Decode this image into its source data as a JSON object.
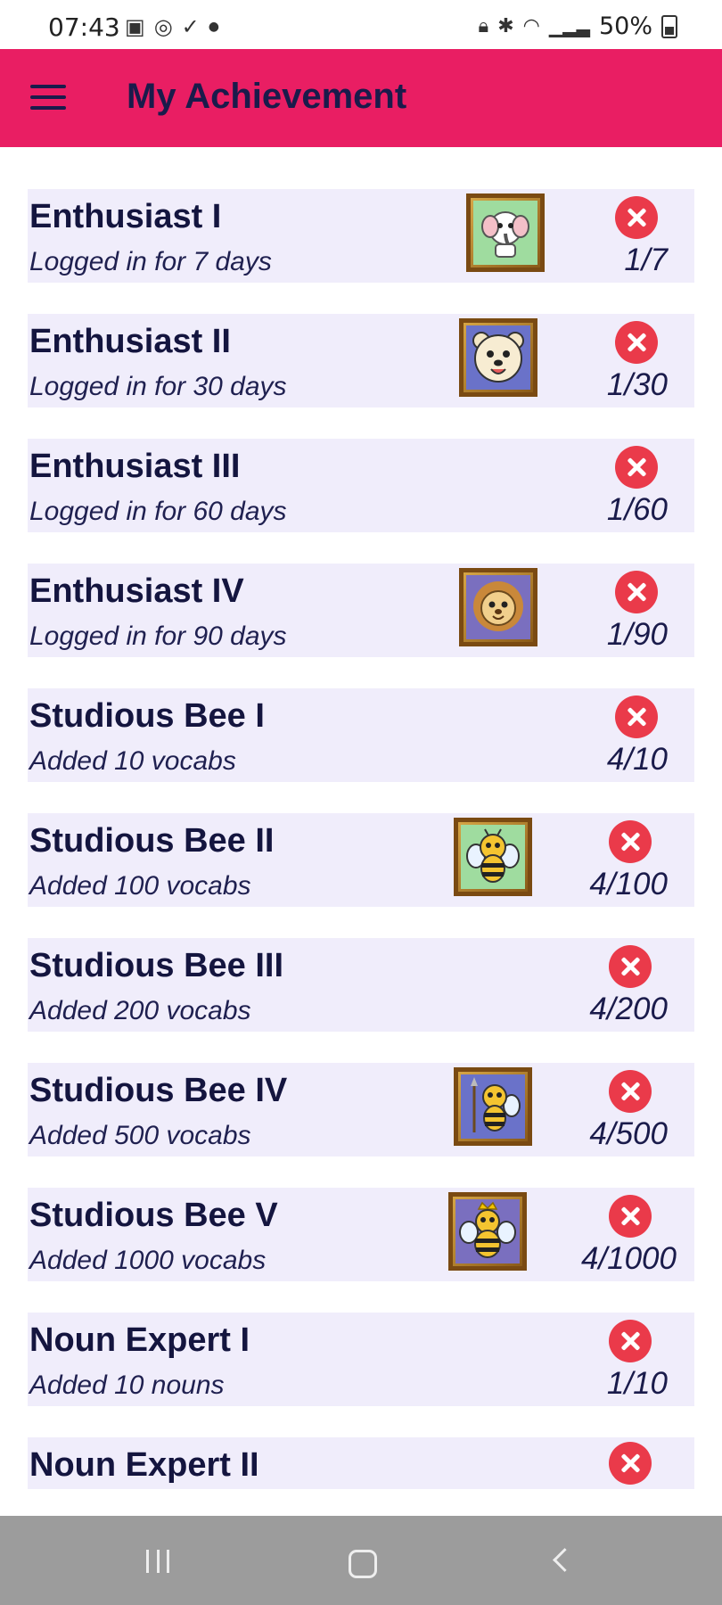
{
  "status_bar": {
    "time": "07:43",
    "battery": "50%",
    "left_icons": [
      "gallery-icon",
      "viber-icon",
      "check-icon",
      "dot-icon"
    ],
    "right_icons": [
      "lock-icon",
      "bluetooth-icon",
      "wifi-icon",
      "signal-icon",
      "battery-icon"
    ]
  },
  "app_bar": {
    "title": "My Achievement",
    "color": "#e91e63"
  },
  "achievements": [
    {
      "title": "Enthusiast I",
      "subtitle": "Logged in for 7 days",
      "progress": "1/7",
      "badge": "elephant",
      "badge_bg": "#9fdc9f",
      "completed": false
    },
    {
      "title": "Enthusiast II",
      "subtitle": "Logged in for 30 days",
      "progress": "1/30",
      "badge": "bear",
      "badge_bg": "#6a72c9",
      "completed": false
    },
    {
      "title": "Enthusiast III",
      "subtitle": "Logged in for 60 days",
      "progress": "1/60",
      "badge": null,
      "completed": false
    },
    {
      "title": "Enthusiast IV",
      "subtitle": "Logged in for 90 days",
      "progress": "1/90",
      "badge": "lion",
      "badge_bg": "#7a6fbf",
      "completed": false
    },
    {
      "title": "Studious Bee I",
      "subtitle": "Added 10 vocabs",
      "progress": "4/10",
      "badge": null,
      "completed": false
    },
    {
      "title": "Studious Bee II",
      "subtitle": "Added 100 vocabs",
      "progress": "4/100",
      "badge": "bee",
      "badge_bg": "#9fdc9f",
      "completed": false
    },
    {
      "title": "Studious Bee III",
      "subtitle": "Added 200 vocabs",
      "progress": "4/200",
      "badge": null,
      "completed": false
    },
    {
      "title": "Studious Bee IV",
      "subtitle": "Added 500 vocabs",
      "progress": "4/500",
      "badge": "bee-warrior",
      "badge_bg": "#6a72c9",
      "completed": false
    },
    {
      "title": "Studious Bee V",
      "subtitle": "Added 1000 vocabs",
      "progress": "4/1000",
      "badge": "bee-queen",
      "badge_bg": "#7a6fbf",
      "completed": false
    },
    {
      "title": "Noun Expert I",
      "subtitle": "Added 10 nouns",
      "progress": "1/10",
      "badge": null,
      "completed": false
    },
    {
      "title": "Noun Expert II",
      "subtitle": "",
      "progress": "",
      "badge": null,
      "completed": false
    }
  ],
  "nav_bar": {
    "icons": [
      "recent-apps-icon",
      "home-icon",
      "back-icon"
    ]
  }
}
